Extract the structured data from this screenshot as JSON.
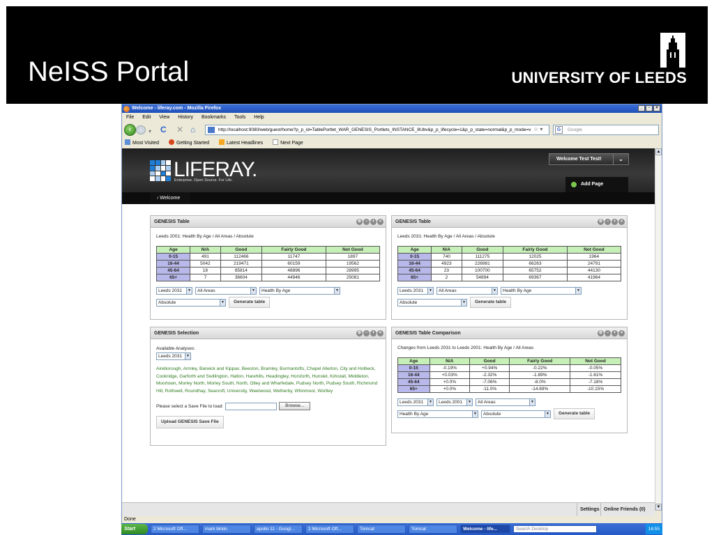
{
  "slide": {
    "title": "NeISS Portal",
    "institution": "UNIVERSITY OF LEEDS"
  },
  "browser": {
    "window_title": "Welcome - liferay.com - Mozilla Firefox",
    "menu": [
      "File",
      "Edit",
      "View",
      "History",
      "Bookmarks",
      "Tools",
      "Help"
    ],
    "url": "http://localhost:9080/web/guest/home?p_p_id=TablePortlet_WAR_GENESIS_Portlets_INSTANCE_8Ubv&p_p_lifecycle=1&p_p_state=normal&p_p_mode=v",
    "search_placeholder": "Google",
    "bookmarks": [
      "Most Visited",
      "Getting Started",
      "Latest Headlines",
      "Next Page"
    ],
    "status": "Done"
  },
  "liferay": {
    "logo_text": "LIFERAY.",
    "tagline": "Enterprise. Open Source. For Life.",
    "welcome_user": "Welcome Test Test!",
    "add_page": "Add Page",
    "nav_tab": "Welcome"
  },
  "portlet1": {
    "title": "GENESIS Table",
    "description": "Leeds 2001: Health By Age / All Areas / Absolute",
    "columns": [
      "Age",
      "N/A",
      "Good",
      "Fairly Good",
      "Not Good"
    ],
    "rows": [
      [
        "0-15",
        "491",
        "112466",
        "11747",
        "1897"
      ],
      [
        "16-44",
        "5042",
        "219471",
        "60159",
        "19562"
      ],
      [
        "45-64",
        "18",
        "85814",
        "48896",
        "28995"
      ],
      [
        "65+",
        "7",
        "36604",
        "44946",
        "25081"
      ]
    ],
    "select_year": "Leeds 2031",
    "select_area": "All Areas",
    "select_measure": "Health By Age",
    "select_type": "Absolute",
    "button": "Generate table"
  },
  "portlet2": {
    "title": "GENESIS Table",
    "description": "Leeds 2031: Health By Age / All Areas / Absolute",
    "columns": [
      "Age",
      "N/A",
      "Good",
      "Fairly Good",
      "Not Good"
    ],
    "rows": [
      [
        "0-15",
        "740",
        "111275",
        "12025",
        "1964"
      ],
      [
        "16-44",
        "4923",
        "226981",
        "66263",
        "24791"
      ],
      [
        "45-64",
        "23",
        "100700",
        "65752",
        "44130"
      ],
      [
        "65+",
        "2",
        "54894",
        "69367",
        "41964"
      ]
    ],
    "select_year": "Leeds 2031",
    "select_area": "All Areas",
    "select_measure": "Health By Age",
    "select_type": "Absolute",
    "button": "Generate table"
  },
  "portlet3": {
    "title": "GENESIS Selection",
    "analyses_label": "Available Analyses:",
    "select_year": "Leeds 2031",
    "areas": "Aireborough, Armley, Barwick and Kippax, Beeston, Bramley, Burmantofts, Chapel Allerton, City and Holbeck, Cookridge, Garforth and Swillington, Halton, Harehills, Headingley, Horsforth, Hunslet, Kirkstall, Middleton, Moortown, Morley North, Morley South, North, Otley and Wharfedale, Pudsey North, Pudsey South, Richmond Hill, Rothwell, Roundhay, Seacroft, University, Weetwood, Wetherby, Whinmoor, Wortley",
    "save_label": "Please select a Save File to load:",
    "browse_button": "Browse...",
    "upload_button": "Upload GENESIS Save File"
  },
  "portlet4": {
    "title": "GENESIS Table Comparison",
    "description": "Changes from Leeds 2031 to Leeds 2001: Health By Age / All Areas",
    "columns": [
      "Age",
      "N/A",
      "Good",
      "Fairly Good",
      "Not Good"
    ],
    "rows": [
      [
        "0-15",
        "-0.19%",
        "+0.94%",
        "-0.22%",
        "-0.05%"
      ],
      [
        "16-44",
        "+0.03%",
        "-2.32%",
        "-1.89%",
        "-1.61%"
      ],
      [
        "45-64",
        "+0.0%",
        "-7.06%",
        "-8.0%",
        "-7.18%"
      ],
      [
        "65+",
        "+0.0%",
        "-11.0%",
        "-14.69%",
        "-10.15%"
      ]
    ],
    "select_year_a": "Leeds 2031",
    "select_year_b": "Leeds 2001",
    "select_area": "All Areas",
    "select_measure": "Health By Age",
    "select_type": "Absolute",
    "button": "Generate table"
  },
  "dock": {
    "settings": "Settings",
    "friends": "Online Friends (0)"
  },
  "taskbar": {
    "start": "Start",
    "items": [
      "2 Microsoft Off...",
      "mark birkin",
      "apollo 11 - Googl...",
      "2 Microsoft Off...",
      "Tomcat",
      "Tomcat",
      "Welcome - life..."
    ],
    "search": "Search Desktop",
    "clock": "16:55"
  }
}
